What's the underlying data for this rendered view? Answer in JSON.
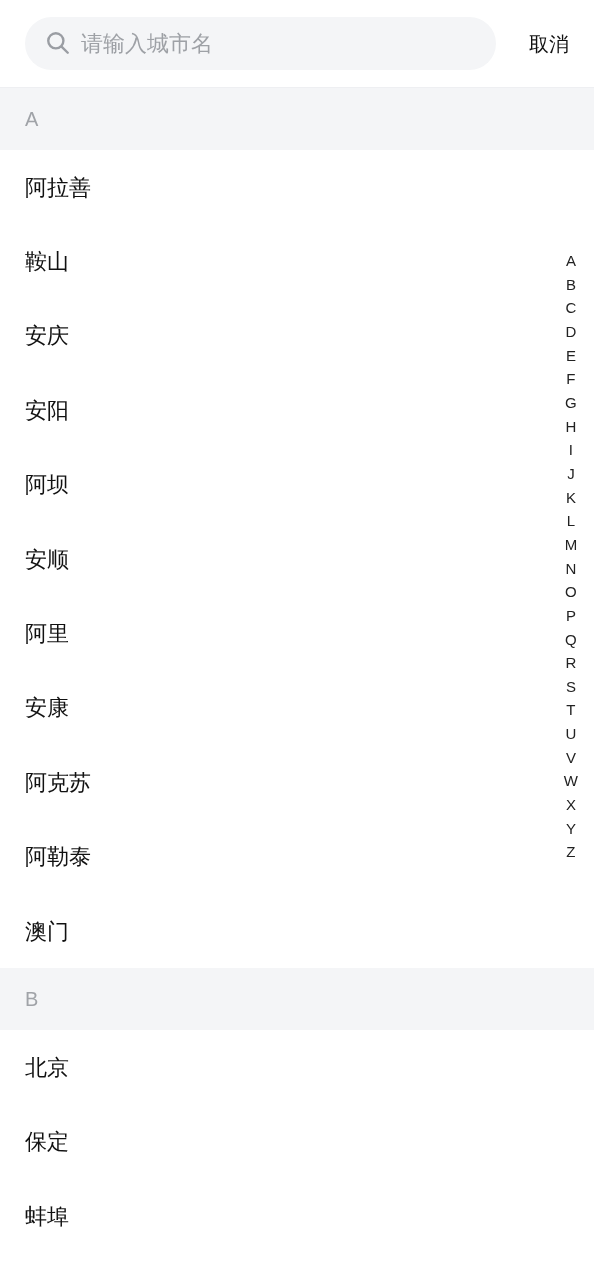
{
  "search": {
    "placeholder": "请输入城市名"
  },
  "cancel": "取消",
  "sections": [
    {
      "letter": "A",
      "cities": [
        "阿拉善",
        "鞍山",
        "安庆",
        "安阳",
        "阿坝",
        "安顺",
        "阿里",
        "安康",
        "阿克苏",
        "阿勒泰",
        "澳门"
      ]
    },
    {
      "letter": "B",
      "cities": [
        "北京",
        "保定",
        "蚌埠"
      ]
    }
  ],
  "index": [
    "A",
    "B",
    "C",
    "D",
    "E",
    "F",
    "G",
    "H",
    "I",
    "J",
    "K",
    "L",
    "M",
    "N",
    "O",
    "P",
    "Q",
    "R",
    "S",
    "T",
    "U",
    "V",
    "W",
    "X",
    "Y",
    "Z"
  ]
}
